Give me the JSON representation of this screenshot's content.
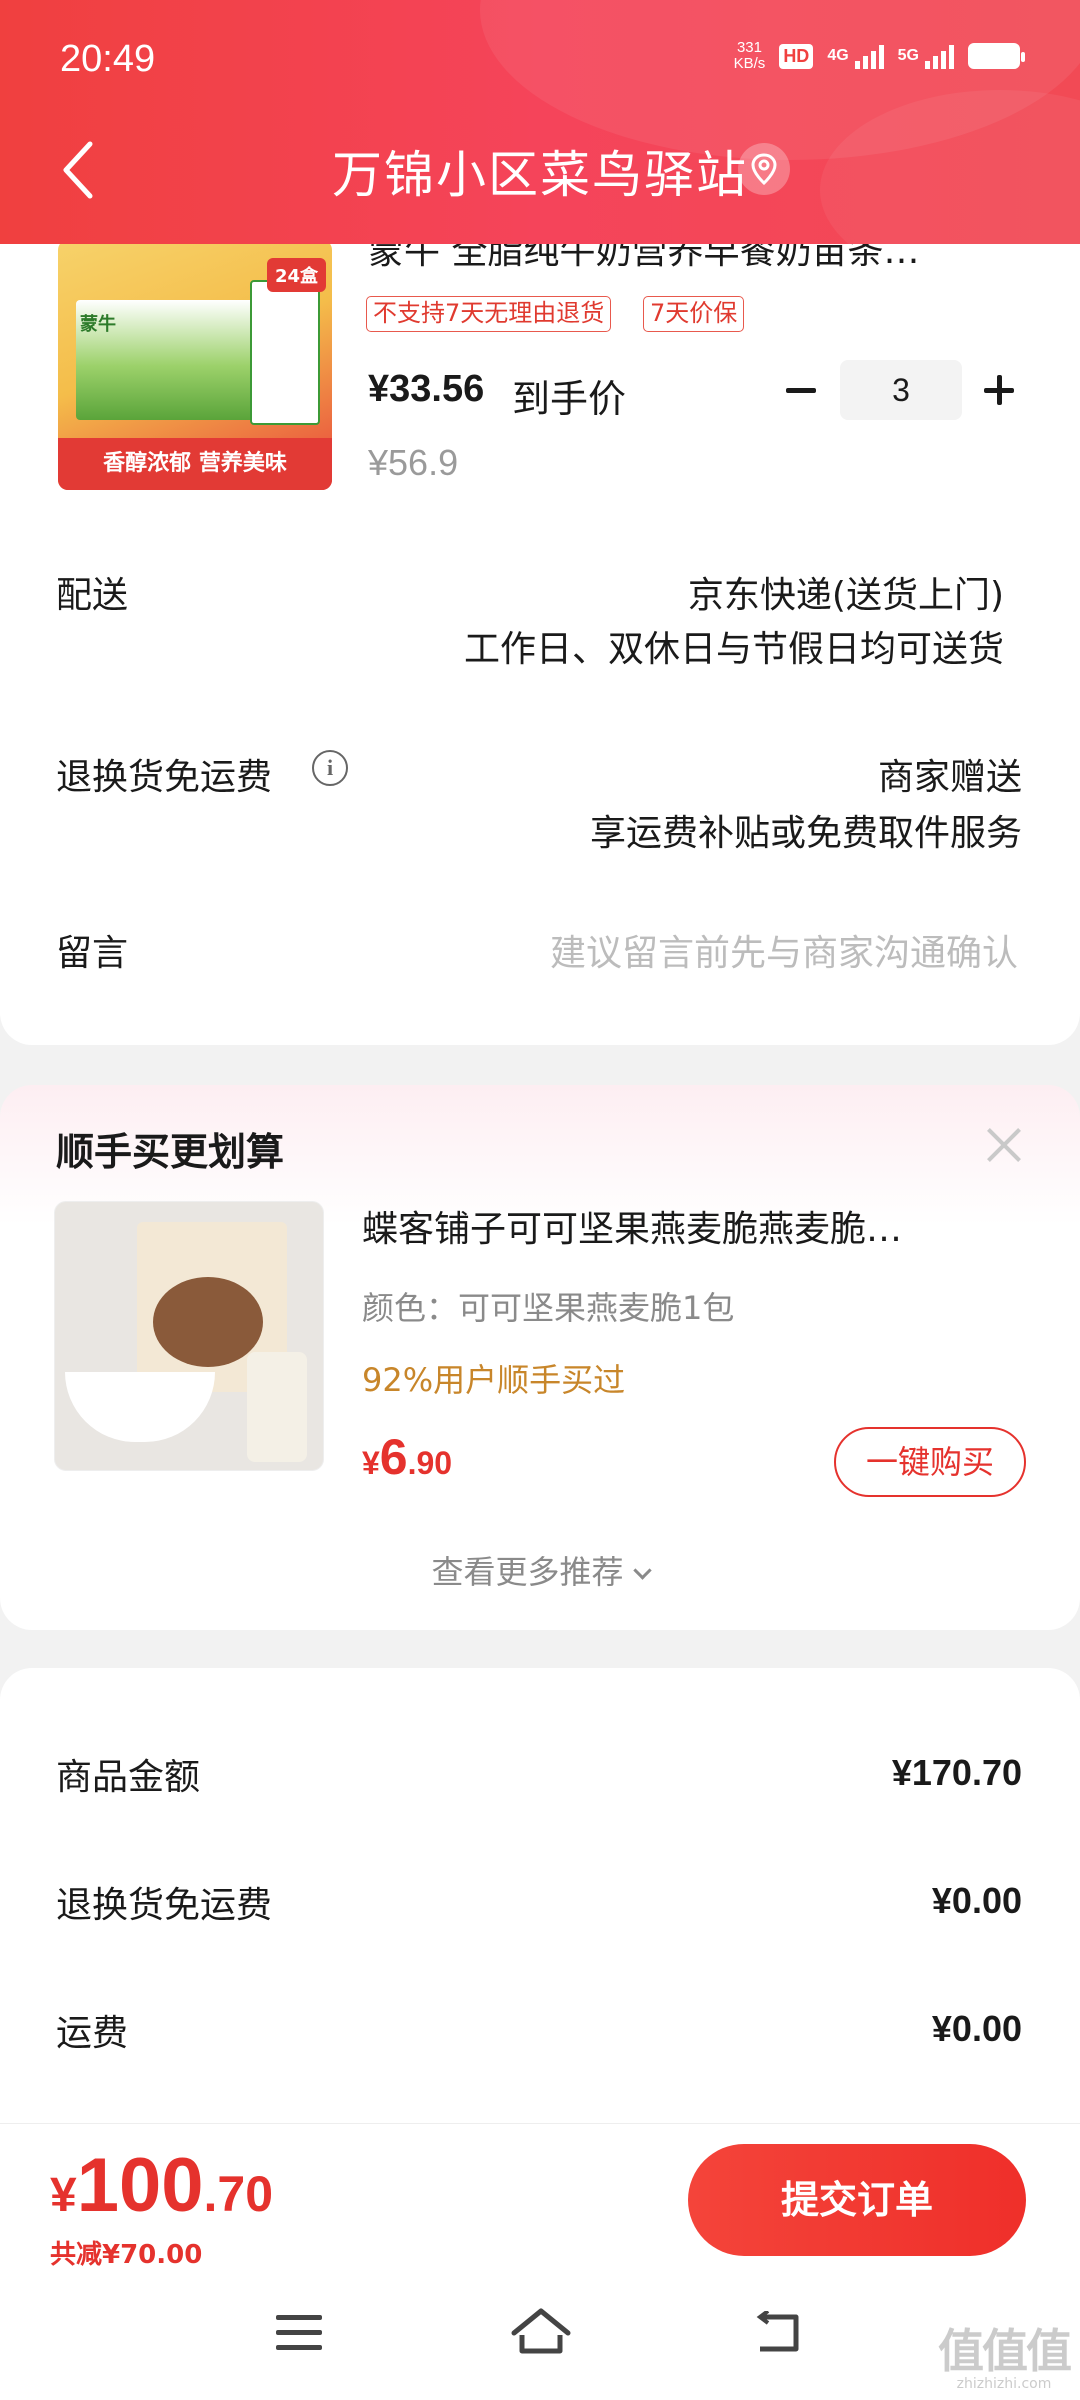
{
  "status_bar": {
    "time": "20:49",
    "speed_value": "331",
    "speed_unit": "KB/s",
    "hd": "HD",
    "net1": "4G",
    "net2": "5G"
  },
  "header": {
    "title": "万锦小区菜鸟驿站",
    "back_icon": "chevron-left-icon",
    "location_icon": "location-pin-icon"
  },
  "product": {
    "title": "蒙牛 全脂纯牛奶营养早餐奶苗条…",
    "image_texts": {
      "brand": "蒙牛",
      "count_badge": "24盒",
      "slogan": "香醇浓郁 营养美味"
    },
    "tags": [
      "不支持7天无理由退货",
      "7天价保"
    ],
    "deal_price": "¥33.56",
    "deal_label": "到手价",
    "original_price": "¥56.9",
    "quantity": "3"
  },
  "delivery": {
    "label": "配送",
    "line1": "京东快递(送货上门)",
    "line2": "工作日、双休日与节假日均可送货"
  },
  "return_shipping": {
    "label": "退换货免运费",
    "value": "商家赠送",
    "desc": "享运费补贴或免费取件服务"
  },
  "message": {
    "label": "留言",
    "placeholder": "建议留言前先与商家沟通确认"
  },
  "recommend": {
    "section_title": "顺手买更划算",
    "item": {
      "title": "蝶客铺子可可坚果燕麦脆燕麦脆…",
      "spec": "颜色：可可坚果燕麦脆1包",
      "note": "92%用户顺手买过",
      "price_symbol": "¥",
      "price_int": "6",
      "price_dec": ".90",
      "buy_label": "一键购买"
    },
    "more_label": "查看更多推荐"
  },
  "amounts": [
    {
      "label": "商品金额",
      "value": "¥170.70"
    },
    {
      "label": "退换货免运费",
      "value": "¥0.00"
    },
    {
      "label": "运费",
      "value": "¥0.00"
    }
  ],
  "checkout": {
    "total_symbol": "¥",
    "total_int": "100",
    "total_dec": ".70",
    "discount": "共减¥70.00",
    "submit_label": "提交订单"
  },
  "watermark": {
    "logo": "值值值",
    "site": "zhizhizhi.com"
  },
  "colors": {
    "brand_red": "#f0403f",
    "price_red": "#e5322d",
    "note_orange": "#c8862a"
  }
}
